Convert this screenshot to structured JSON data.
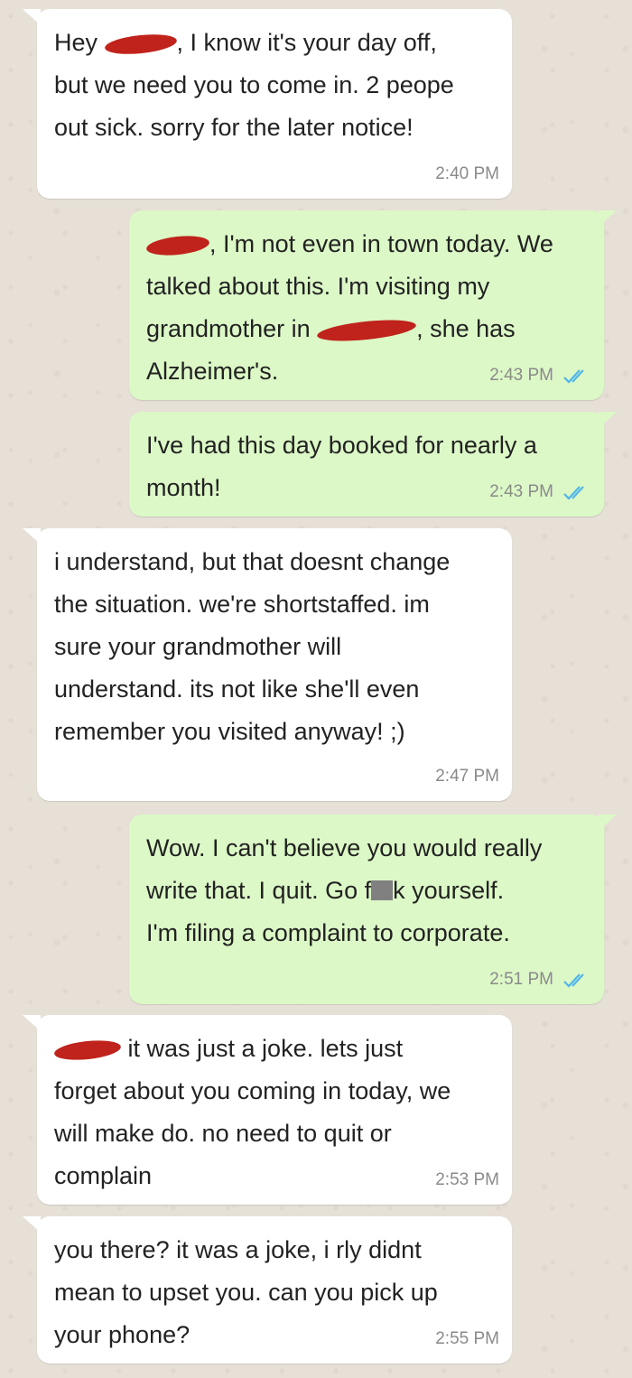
{
  "colors": {
    "incoming_bubble": "#ffffff",
    "outgoing_bubble": "#dcf8c6",
    "background": "#e5dfd6",
    "text": "#222222",
    "timestamp": "#8a8a8a",
    "read_ticks": "#4fb6ec",
    "redaction": "#c0231b",
    "censor_box": "#808080"
  },
  "messages": [
    {
      "direction": "incoming",
      "lines": [
        {
          "before": "Hey ",
          "redacted": true,
          "after": ", I know it's your day off,"
        },
        {
          "text": "but we need you to come in. 2 peope"
        },
        {
          "text": "out sick. sorry for the later notice!"
        }
      ],
      "time": "2:40 PM"
    },
    {
      "direction": "outgoing",
      "lines": [
        {
          "redacted": true,
          "after": ", I'm not even in town today. We"
        },
        {
          "text": "talked about this. I'm visiting my"
        },
        {
          "before": "grandmother in ",
          "redacted": true,
          "after": ", she has"
        },
        {
          "text": "Alzheimer's."
        }
      ],
      "time": "2:43 PM",
      "status_icon": "double-check-read-icon"
    },
    {
      "direction": "outgoing",
      "lines": [
        {
          "text": "I've had this day booked for nearly a"
        },
        {
          "text": "month!"
        }
      ],
      "time": "2:43 PM",
      "status_icon": "double-check-read-icon"
    },
    {
      "direction": "incoming",
      "lines": [
        {
          "text": "i understand, but that doesnt change"
        },
        {
          "text": "the situation. we're shortstaffed. im"
        },
        {
          "text": "sure your grandmother will"
        },
        {
          "text": "understand. its not like she'll even"
        },
        {
          "text": "remember you visited anyway! ;)"
        }
      ],
      "time": "2:47 PM"
    },
    {
      "direction": "outgoing",
      "lines": [
        {
          "text": "Wow. I can't believe you would really"
        },
        {
          "before": "write that. I quit. Go f",
          "censored": true,
          "after": "k yourself."
        },
        {
          "text": "I'm filing a complaint to corporate."
        }
      ],
      "time": "2:51 PM",
      "status_icon": "double-check-read-icon"
    },
    {
      "direction": "incoming",
      "lines": [
        {
          "redacted": true,
          "after": " it was just a joke. lets just"
        },
        {
          "text": "forget about you coming in today, we"
        },
        {
          "text": "will make do. no need to quit or"
        },
        {
          "text": "complain"
        }
      ],
      "time": "2:53 PM"
    },
    {
      "direction": "incoming",
      "lines": [
        {
          "text": "you there? it was a joke, i rly didnt"
        },
        {
          "text": "mean to upset you. can you pick up"
        },
        {
          "text": "your phone?"
        }
      ],
      "time": "2:55 PM"
    }
  ]
}
